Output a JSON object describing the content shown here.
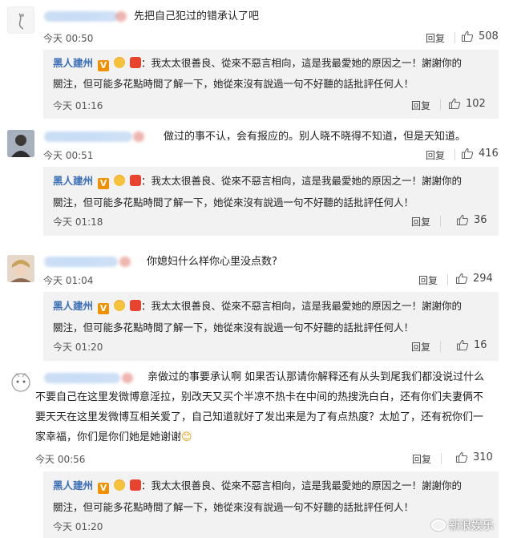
{
  "comments": [
    {
      "text": "先把自己犯过的错承认了吧",
      "time": "今天 00:50",
      "reply_label": "回复",
      "likes": "508",
      "reply": {
        "author": "黑人建州",
        "line1": "：我太太很善良、從來不惡言相向，這是我最愛她的原因之一！謝謝你的",
        "line2": "關注，但可能多花點時間了解一下，她從來沒有說過一句不好聽的話批評任何人！",
        "time": "今天 01:16",
        "reply_label": "回复",
        "likes": "102"
      }
    },
    {
      "text": "做过的事不认，会有报应的。别人晓不晓得不知道，但是天知道。",
      "time": "今天 00:51",
      "reply_label": "回复",
      "likes": "416",
      "reply": {
        "author": "黑人建州",
        "line1": "：我太太很善良、從來不惡言相向，這是我最愛她的原因之一！謝謝你的",
        "line2": "關注，但可能多花點時間了解一下，她從來沒有說過一句不好聽的話批評任何人！",
        "time": "今天 01:18",
        "reply_label": "回复",
        "likes": "36"
      }
    },
    {
      "text": "你媳妇什么样你心里没点数?",
      "time": "今天 01:04",
      "reply_label": "回复",
      "likes": "294",
      "reply": {
        "author": "黑人建州",
        "line1": "：我太太很善良、從來不惡言相向，這是我最愛她的原因之一！謝謝你的",
        "line2": "關注，但可能多花點時間了解一下，她從來沒有說過一句不好聽的話批評任何人！",
        "time": "今天 01:20",
        "reply_label": "回复",
        "likes": "16"
      }
    },
    {
      "text_line1": "亲做过的事要承认啊 如果否认那请你解释还有从头到尾我们都没说过什么",
      "text_line2": "不要自己在这里发微博意淫拉，别改天又买个半凉不热卡在中间的热搜洗白白，还有你们夫妻俩不",
      "text_line3": "要天天在这里发微博互相关爱了，自己知道就好了发出来是为了有点热度？太尬了，还有祝你们一",
      "text_line4": "家幸福，你们是你们她是她谢谢",
      "emoji": "😊",
      "time": "今天 00:56",
      "reply_label": "回复",
      "likes": "310",
      "reply": {
        "author": "黑人建州",
        "line1": "：我太太很善良、從來不惡言相向，這是我最愛她的原因之一！謝謝你的",
        "line2": "關注，但可能多花點時間了解一下，她從來沒有說過一句不好聽的話批評任何人！",
        "time": "今天 01:20"
      }
    }
  ],
  "badge_v": "V",
  "watermark": "新浪娱乐",
  "colors": {
    "author": "#3a6fb5",
    "reply_bg": "#f2f2f2",
    "v_badge": "#f29100"
  }
}
